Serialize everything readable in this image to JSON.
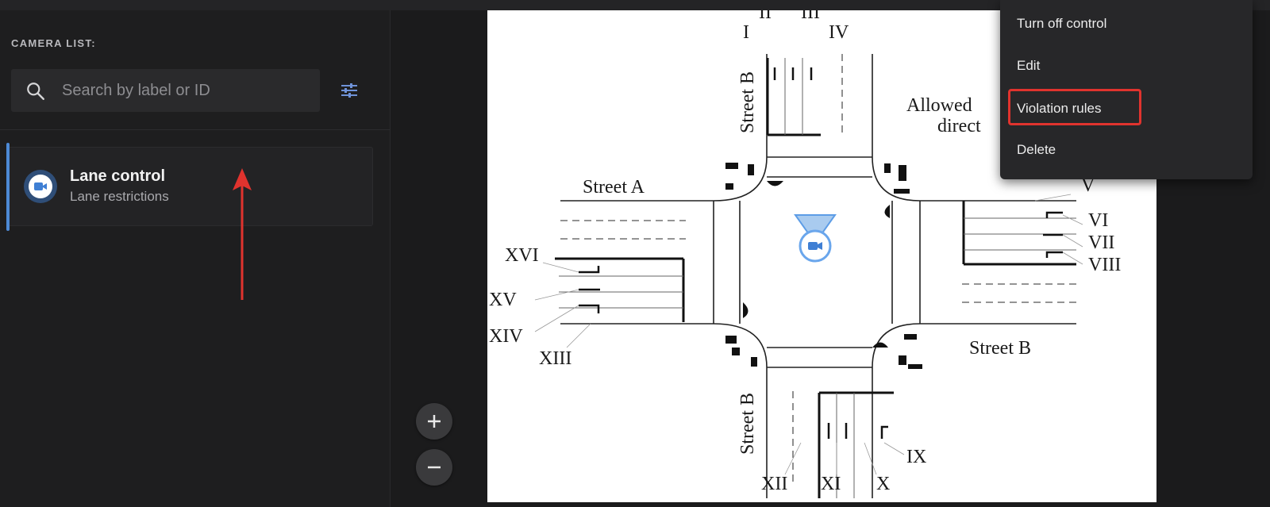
{
  "sidebar": {
    "title": "CAMERA LIST:",
    "search": {
      "placeholder": "Search by label or ID",
      "value": ""
    },
    "cameras": [
      {
        "title": "Lane control",
        "subtitle": "Lane restrictions"
      }
    ]
  },
  "context_menu": {
    "items": [
      {
        "label": "Turn off control"
      },
      {
        "label": "Edit"
      },
      {
        "label": "Violation rules"
      },
      {
        "label": "Delete"
      }
    ]
  },
  "diagram": {
    "street_a": "Street A",
    "street_b_top": "Street B",
    "street_b_right": "Street B",
    "street_b_bottom": "Street B",
    "allowed_line1": "Allowed",
    "allowed_line2": "direct",
    "lanes": {
      "I": "I",
      "II": "II",
      "III": "III",
      "IV": "IV",
      "V": "V",
      "VI": "VI",
      "VII": "VII",
      "VIII": "VIII",
      "IX": "IX",
      "X": "X",
      "XI": "XI",
      "XII": "XII",
      "XIII": "XIII",
      "XIV": "XIV",
      "XV": "XV",
      "XVI": "XVI"
    }
  },
  "colors": {
    "accent": "#4d8ad6",
    "annotation_red": "#e0332e",
    "menu_bg": "#272729"
  }
}
